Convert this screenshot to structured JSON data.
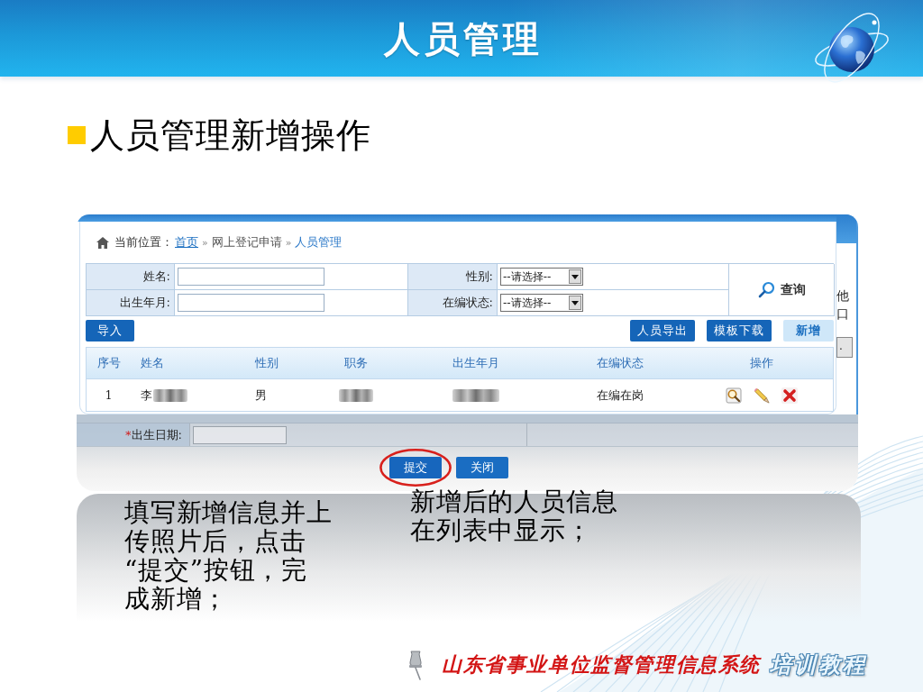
{
  "header": {
    "title": "人员管理"
  },
  "heading": {
    "text": "人员管理新增操作"
  },
  "form_screenshot": {
    "edge_fragments": [
      "他",
      "口"
    ],
    "edge_button": ".",
    "required_mark": "*",
    "field_label": "出生日期:",
    "buttons": [
      {
        "label": "提交",
        "highlighted": true
      },
      {
        "label": "关闭",
        "highlighted": false
      }
    ]
  },
  "list_screenshot": {
    "breadcrumb": {
      "label": "当前位置：",
      "items": [
        {
          "text": "首页",
          "kind": "link"
        },
        {
          "separator": "»",
          "text": "网上登记申请",
          "kind": "plain"
        },
        {
          "separator": "»",
          "text": "人员管理",
          "kind": "current"
        }
      ]
    },
    "search_form": {
      "fields": [
        {
          "label": "姓名:",
          "kind": "input"
        },
        {
          "label": "性别:",
          "kind": "select",
          "value": "--请选择--"
        },
        {
          "label": "出生年月:",
          "kind": "input"
        },
        {
          "label": "在编状态:",
          "kind": "select",
          "value": "--请选择--"
        }
      ],
      "query_button": "查询"
    },
    "toolbar": {
      "left": [
        {
          "label": "导入",
          "kind": "primary"
        }
      ],
      "right": [
        {
          "label": "人员导出",
          "kind": "primary"
        },
        {
          "label": "模板下载",
          "kind": "primary"
        },
        {
          "label": "新增",
          "kind": "light"
        }
      ]
    },
    "table": {
      "columns": [
        "序号",
        "姓名",
        "性别",
        "职务",
        "出生年月",
        "在编状态",
        "操作"
      ],
      "rows": [
        {
          "cells": [
            {
              "kind": "text",
              "text": "1"
            },
            {
              "kind": "text_blurred",
              "text": "李"
            },
            {
              "kind": "text",
              "text": "男"
            },
            {
              "kind": "blurred"
            },
            {
              "kind": "blurred"
            },
            {
              "kind": "text",
              "text": "在编在岗"
            },
            {
              "kind": "actions"
            }
          ]
        }
      ]
    }
  },
  "caption_left": {
    "lines": [
      "填写新增信息并上",
      "传照片后，点击",
      "“提交”按钮，完",
      "成新增；"
    ]
  },
  "caption_right": {
    "lines": [
      "新增后的人员信息",
      "在列表中显示；"
    ]
  },
  "footer": {
    "system_name": "山东省事业单位监督管理信息系统",
    "tagline": "培训教程"
  }
}
